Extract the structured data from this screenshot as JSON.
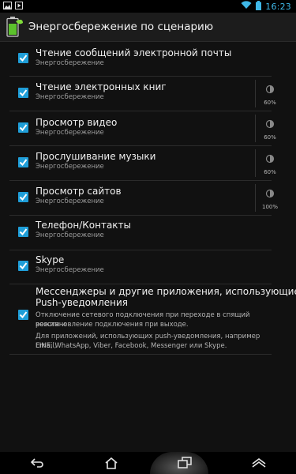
{
  "status_bar": {
    "time": "16:23",
    "left_icons": [
      "image-icon",
      "play-icon"
    ],
    "right_icons": [
      "wifi-icon",
      "battery-icon"
    ]
  },
  "action_bar": {
    "title": "Энергосбережение по сценарию",
    "app_icon": "battery-leaf-icon"
  },
  "scenarios": [
    {
      "title": "Чтение сообщений электронной почты",
      "subtitle": "Энергосбережение",
      "checked": true,
      "brightness": null
    },
    {
      "title": "Чтение электронных книг",
      "subtitle": "Энергосбережение",
      "checked": true,
      "brightness": "60%"
    },
    {
      "title": "Просмотр видео",
      "subtitle": "Энергосбережение",
      "checked": true,
      "brightness": "60%"
    },
    {
      "title": "Прослушивание музыки",
      "subtitle": "Энергосбережение",
      "checked": true,
      "brightness": "60%"
    },
    {
      "title": "Просмотр сайтов",
      "subtitle": "Энергосбережение",
      "checked": true,
      "brightness": "100%"
    },
    {
      "title": "Телефон/Контакты",
      "subtitle": "Энергосбережение",
      "checked": true,
      "brightness": null
    },
    {
      "title": "Skype",
      "subtitle": "Энергосбережение",
      "checked": true,
      "brightness": null
    }
  ],
  "messengers": {
    "title_line1": "Мессенджеры и другие приложения, использующие",
    "title_line2": "Push-уведомления",
    "desc_line1": "Отключение сетевого подключения при переходе в спящий режим и",
    "desc_line2": "восстановление подключения при выходе.",
    "note_line1": "Для приложений, использующих push-уведомления, например Email,",
    "note_line2": "LINE, WhatsApp, Viber, Facebook, Messenger или Skype.",
    "checked": true
  },
  "nav_bar": {
    "buttons": [
      "back-icon",
      "home-icon",
      "recent-apps-icon",
      "menu-up-icon"
    ]
  },
  "colors": {
    "accent": "#1f9ed8",
    "time": "#3fb8e8",
    "background": "#111111"
  }
}
